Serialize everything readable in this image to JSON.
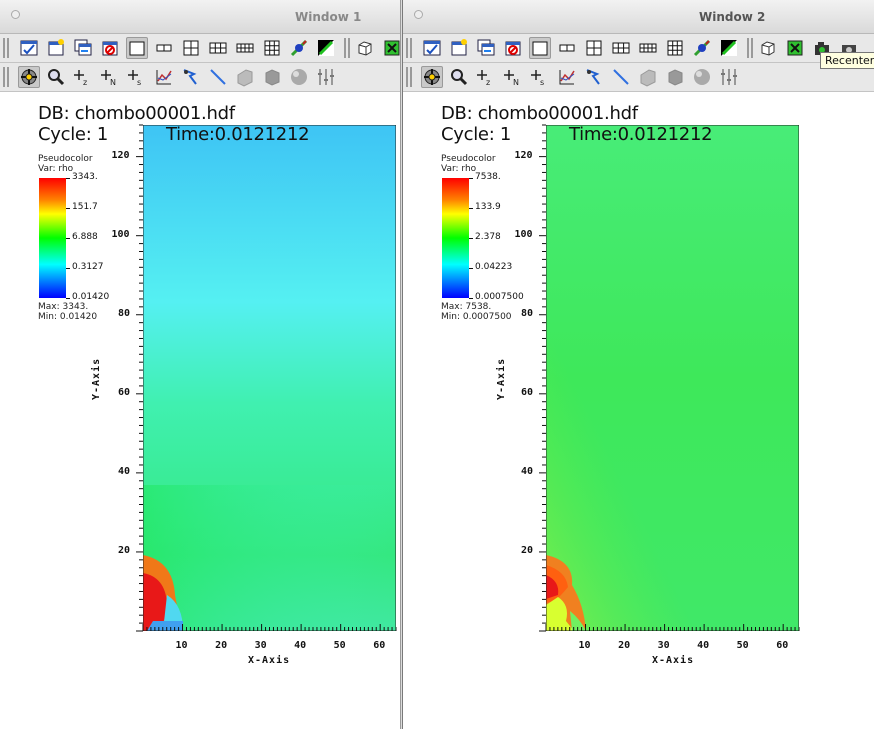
{
  "windows": [
    {
      "title": "Window 1",
      "db": "DB: chombo00001.hdf",
      "cycle": "Cycle: 1",
      "time": "Time:0.0121212",
      "legend": {
        "plot_type": "Pseudocolor",
        "var": "Var: rho",
        "labels": [
          "3343.",
          "151.7",
          "6.888",
          "0.3127",
          "0.01420"
        ],
        "max": "Max:  3343.",
        "min": "Min:  0.01420"
      },
      "axes": {
        "xlabel": "X-Axis",
        "ylabel": "Y-Axis",
        "xticks": [
          "10",
          "20",
          "30",
          "40",
          "50",
          "60"
        ],
        "yticks": [
          "20",
          "40",
          "60",
          "80",
          "100",
          "120"
        ]
      }
    },
    {
      "title": "Window 2",
      "db": "DB: chombo00001.hdf",
      "cycle": "Cycle: 1",
      "time": "Time:0.0121212",
      "legend": {
        "plot_type": "Pseudocolor",
        "var": "Var: rho",
        "labels": [
          "7538.",
          "133.9",
          "2.378",
          "0.04223",
          "0.0007500"
        ],
        "max": "Max:  7538.",
        "min": "Min:  0.0007500"
      },
      "axes": {
        "xlabel": "X-Axis",
        "ylabel": "Y-Axis",
        "xticks": [
          "10",
          "20",
          "30",
          "40",
          "50",
          "60"
        ],
        "yticks": [
          "20",
          "40",
          "60",
          "80",
          "100",
          "120"
        ]
      }
    }
  ],
  "tooltip": "Recenter",
  "toolbar_icons_row1": [
    "add-plot-icon",
    "new-window-icon",
    "clone-window-icon",
    "delete-window-icon",
    "layout-1x1-icon",
    "layout-1x2-icon",
    "layout-2x2-icon",
    "layout-2x3-icon",
    "layout-2x4-icon",
    "layout-3x3-icon",
    "lock-view-icon",
    "invert-icon",
    "view-3d-icon",
    "reset-view-icon",
    "recenter-icon",
    "save-image-icon"
  ],
  "toolbar_icons_row2": [
    "navigate-icon",
    "zoom-icon",
    "zone-pick-icon",
    "node-pick-icon",
    "spreadsheet-pick-icon",
    "lineout-icon",
    "pick-arrow-icon",
    "line-tool-icon",
    "plane-tool-icon",
    "box-tool-icon",
    "sphere-tool-icon",
    "axis-restrict-icon"
  ],
  "colors": {
    "win1_field_top": "#40c8f0",
    "win1_field_mid": "#50f0f0",
    "win1_field_bottom": "#30e090",
    "win2_field": "#40e860",
    "accent_red": "#e02020"
  }
}
